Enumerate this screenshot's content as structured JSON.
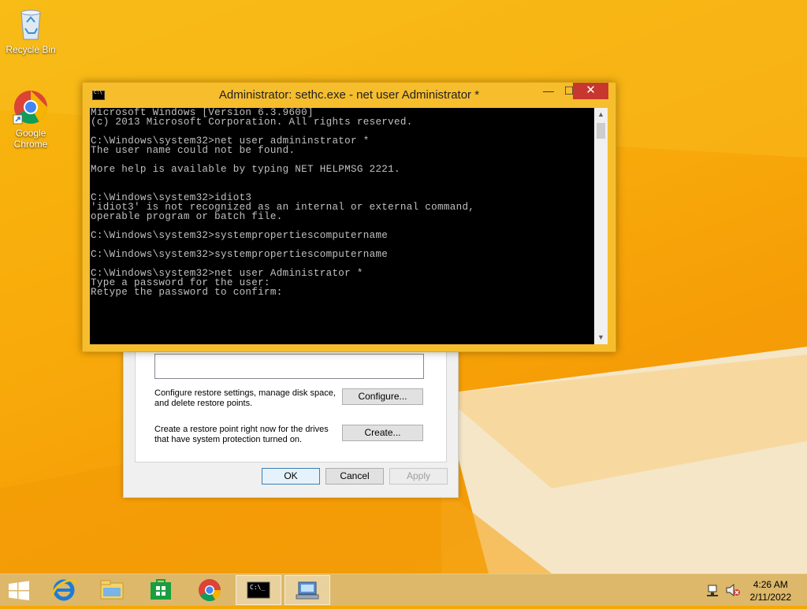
{
  "desktop": {
    "icons": [
      {
        "label": "Recycle Bin"
      },
      {
        "label": "Google Chrome"
      }
    ]
  },
  "cmd": {
    "title": "Administrator: sethc.exe - net  user Administrator *",
    "lines": [
      "Microsoft Windows [Version 6.3.9600]",
      "(c) 2013 Microsoft Corporation. All rights reserved.",
      "",
      "C:\\Windows\\system32>net user admininstrator *",
      "The user name could not be found.",
      "",
      "More help is available by typing NET HELPMSG 2221.",
      "",
      "",
      "C:\\Windows\\system32>idiot3",
      "'idiot3' is not recognized as an internal or external command,",
      "operable program or batch file.",
      "",
      "C:\\Windows\\system32>systempropertiescomputername",
      "",
      "C:\\Windows\\system32>systempropertiescomputername",
      "",
      "C:\\Windows\\system32>net user Administrator *",
      "Type a password for the user:",
      "Retype the password to confirm:"
    ],
    "buttons": {
      "minimize": "—",
      "maximize": "☐",
      "close": "✕"
    }
  },
  "system_properties": {
    "configure_desc": "Configure restore settings, manage disk space, and delete restore points.",
    "configure_label": "Configure...",
    "create_desc": "Create a restore point right now for the drives that have system protection turned on.",
    "create_label": "Create...",
    "ok_label": "OK",
    "cancel_label": "Cancel",
    "apply_label": "Apply"
  },
  "taskbar": {
    "clock_time": "4:26 AM",
    "clock_date": "2/11/2022",
    "cmd_icon_text": "C:\\_"
  },
  "colors": {
    "desktop": "#f7b80f",
    "window_frame": "#f6bd2d",
    "close_button": "#c7372f",
    "taskbar": "#ddb86a"
  }
}
